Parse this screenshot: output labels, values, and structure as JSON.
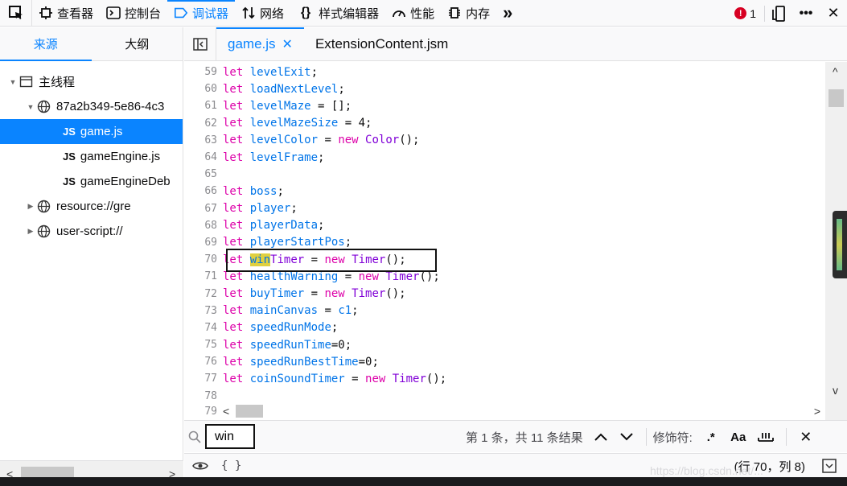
{
  "toolbar": {
    "tabs": [
      {
        "label": "查看器",
        "icon": "inspector-icon"
      },
      {
        "label": "控制台",
        "icon": "console-icon"
      },
      {
        "label": "调试器",
        "icon": "debugger-icon",
        "active": true
      },
      {
        "label": "网络",
        "icon": "network-icon"
      },
      {
        "label": "样式编辑器",
        "icon": "style-editor-icon"
      },
      {
        "label": "性能",
        "icon": "performance-icon"
      },
      {
        "label": "内存",
        "icon": "memory-icon"
      }
    ],
    "more": "»",
    "error_count": "1",
    "error_glyph": "!",
    "menu": "•••",
    "close": "✕"
  },
  "sidebar": {
    "tabs": [
      "来源",
      "大纲"
    ],
    "tree": {
      "main_thread": "主线程",
      "origin": "87a2b349-5e86-4c3",
      "files": [
        {
          "tag": "JS",
          "name": "game.js",
          "selected": true
        },
        {
          "tag": "JS",
          "name": "gameEngine.js"
        },
        {
          "tag": "JS",
          "name": "gameEngineDeb"
        }
      ],
      "resource": "resource://gre",
      "userscript": "user-script://"
    }
  },
  "editor": {
    "tabs": [
      {
        "name": "game.js",
        "close": "✕"
      },
      {
        "name": "ExtensionContent.jsm"
      }
    ],
    "line_numbers": [
      "59",
      "60",
      "61",
      "62",
      "63",
      "64",
      "65",
      "66",
      "67",
      "68",
      "69",
      "70",
      "71",
      "72",
      "73",
      "74",
      "75",
      "76",
      "77",
      "78"
    ],
    "code": [
      [
        "let",
        " levelExit",
        ";"
      ],
      [
        "let",
        " loadNextLevel",
        ";"
      ],
      [
        "let",
        " levelMaze",
        " = [];"
      ],
      [
        "let",
        " levelMazeSize",
        " = 4;"
      ],
      [
        "let",
        " levelColor",
        " = ",
        "new",
        " Color",
        "();"
      ],
      [
        "let",
        " levelFrame",
        ";"
      ],
      [],
      [
        "let",
        " boss",
        ";"
      ],
      [
        "let",
        " player",
        ";"
      ],
      [
        "let",
        " playerData",
        ";"
      ],
      [
        "let",
        " playerStartPos",
        ";"
      ],
      [
        "let",
        " ",
        "win",
        "Timer",
        " = ",
        "new",
        " Timer",
        "();"
      ],
      [
        "let",
        " healthWarning",
        " = ",
        "new",
        " Timer",
        "();"
      ],
      [
        "let",
        " buyTimer",
        " = ",
        "new",
        " Timer",
        "();"
      ],
      [
        "let",
        " mainCanvas",
        " = ",
        "c1",
        ";"
      ],
      [
        "let",
        " speedRunMode",
        ";"
      ],
      [
        "let",
        " speedRunTime",
        "=0;"
      ],
      [
        "let",
        " speedRunBestTime",
        "=0;"
      ],
      [
        "let",
        " coinSoundTimer",
        " = ",
        "new",
        " Timer",
        "();"
      ],
      []
    ],
    "last_partial_line": "79",
    "scroll_left": "<",
    "scroll_right": ">",
    "scroll_up": "^",
    "scroll_down": "v"
  },
  "search": {
    "query": "win",
    "result_text": "第 1 条，共 11 条结果",
    "modifiers_label": "修饰符:",
    "regex_label": ".*",
    "case_label": "Aa",
    "whole_word_label": "\"",
    "close": "✕"
  },
  "footer": {
    "pretty_print": "{ }",
    "cursor_position": "(行 70，列 8)"
  },
  "sidebar_scroll": {
    "left": "<",
    "right": ">"
  },
  "watermark": "https://blog.csdn.net/...",
  "colors": {
    "accent": "#0a84ff",
    "keyword": "#dd00a9",
    "identifier": "#0074e8",
    "type": "#8000d7",
    "error": "#d70022",
    "match_highlight": "#e0d040"
  }
}
